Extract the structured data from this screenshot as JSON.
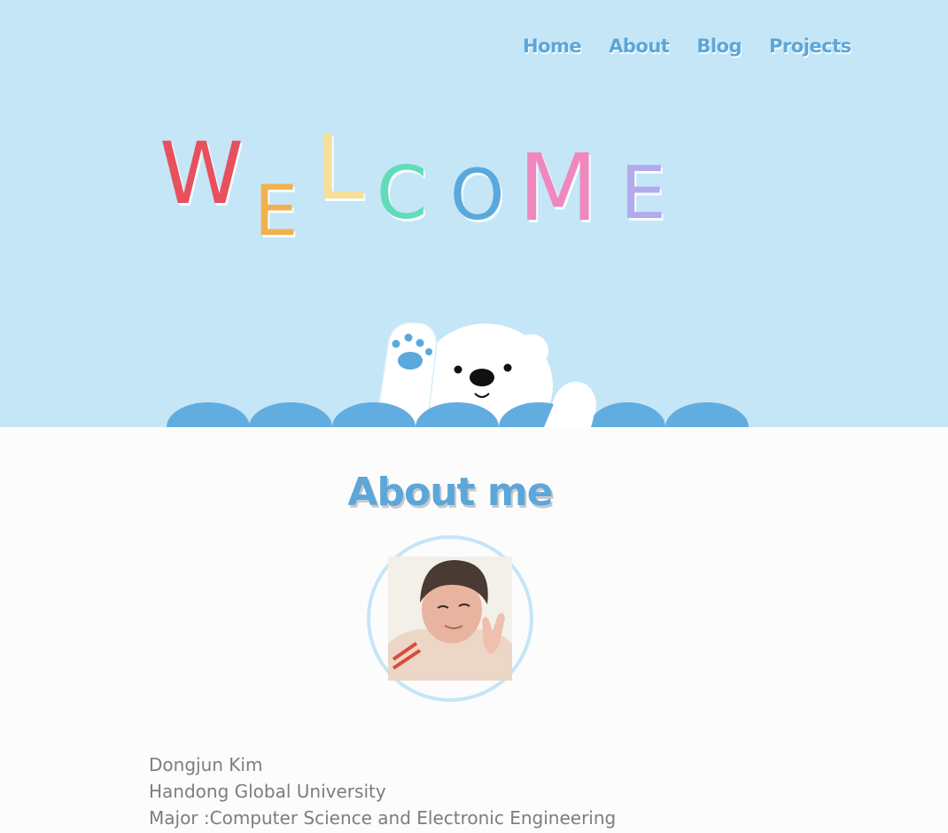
{
  "nav": {
    "home": "Home",
    "about": "About",
    "blog": "Blog",
    "projects": "Projects"
  },
  "hero": {
    "welcome_letters": [
      "W",
      "E",
      "L",
      "C",
      "O",
      "M",
      "E"
    ],
    "letter_colors": [
      "#e8505e",
      "#f2b14f",
      "#f6df9a",
      "#62dcb8",
      "#5aa8dc",
      "#ee88bf",
      "#b3aaee"
    ],
    "bear_paw_color": "#5aa8dc",
    "wave_color": "#62ade0"
  },
  "about": {
    "title": "About me",
    "name": "Dongjun Kim",
    "school": "Handong Global University",
    "major": "Major :Computer Science and Electronic Engineering"
  },
  "colors": {
    "sky": "#c4e6f7",
    "accent": "#5ca6d9",
    "page_bg": "#fcfcfc",
    "text": "#7d7d7d"
  }
}
